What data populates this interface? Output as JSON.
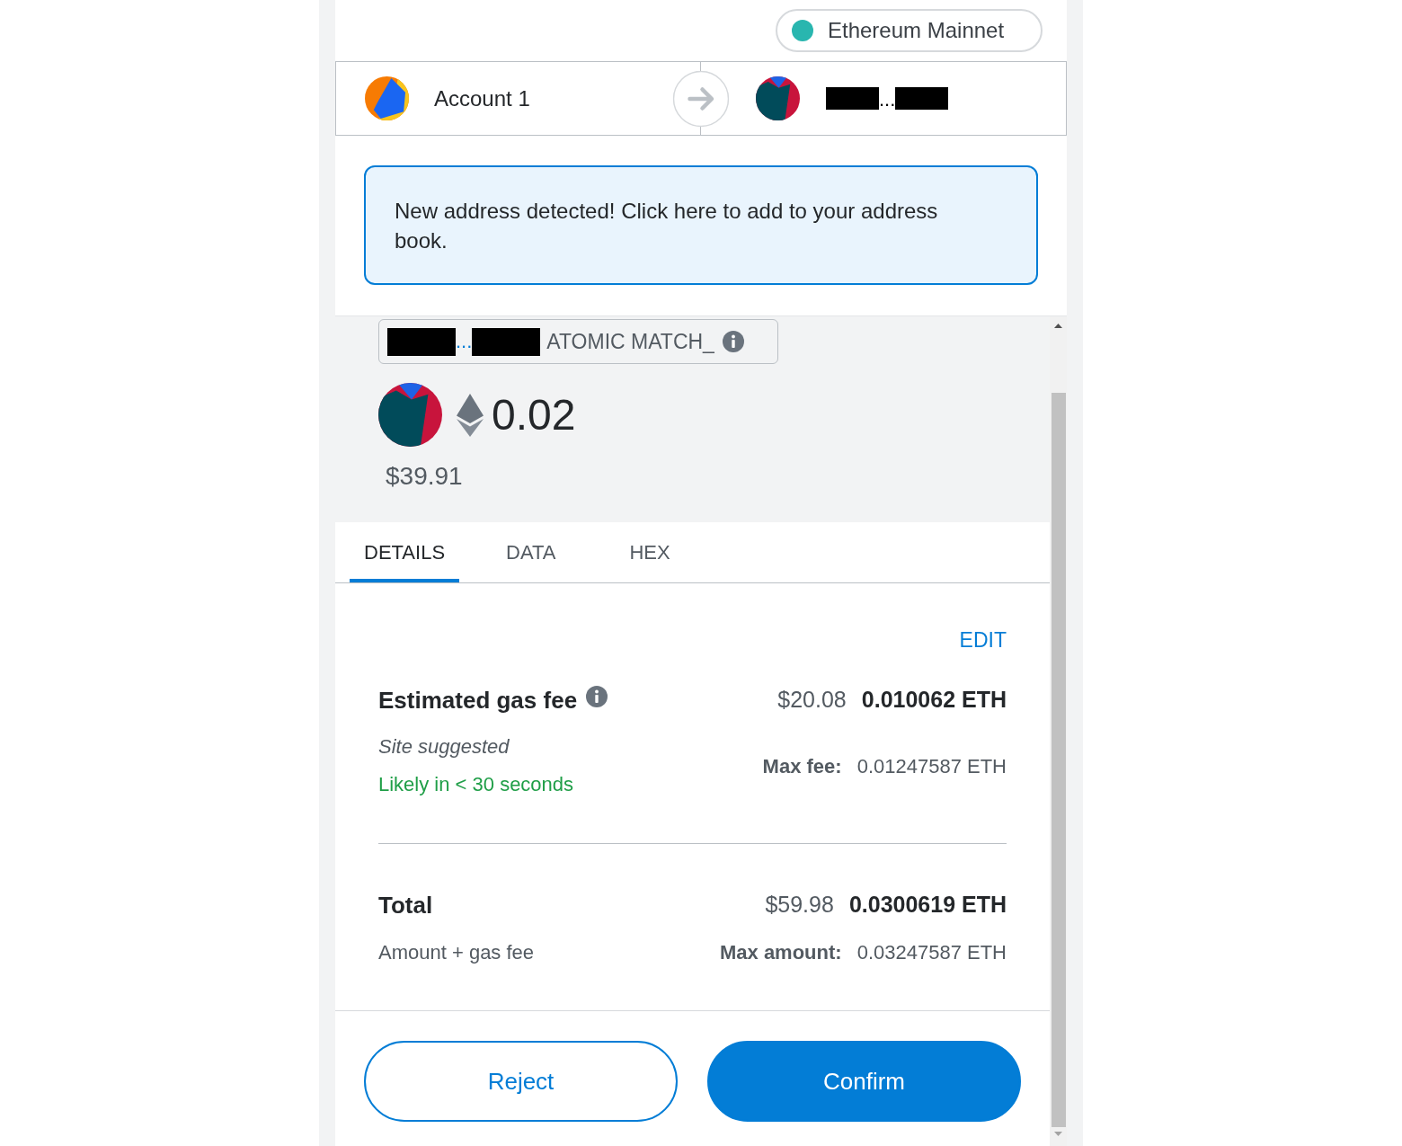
{
  "network": {
    "name": "Ethereum Mainnet"
  },
  "sender": {
    "name": "Account 1"
  },
  "recipient": {
    "address_ellipsis": "..."
  },
  "notice": {
    "text": "New address detected! Click here to add to your address book."
  },
  "transaction": {
    "address_ellipsis": "...",
    "method": "ATOMIC MATCH_",
    "amount": "0.02",
    "fiat": "$39.91"
  },
  "tabs": [
    {
      "label": "DETAILS",
      "selected": true
    },
    {
      "label": "DATA",
      "selected": false
    },
    {
      "label": "HEX",
      "selected": false
    }
  ],
  "details": {
    "edit": "EDIT",
    "gas_fee": {
      "label": "Estimated gas fee",
      "fiat": "$20.08",
      "eth": "0.010062 ETH",
      "source": "Site suggested",
      "timing": "Likely in < 30 seconds",
      "max_label": "Max fee:",
      "max_value": "0.01247587 ETH"
    },
    "total": {
      "label": "Total",
      "fiat": "$59.98",
      "eth": "0.0300619 ETH",
      "note": "Amount + gas fee",
      "max_label": "Max amount:",
      "max_value": "0.03247587 ETH"
    }
  },
  "buttons": [
    {
      "label": "Reject",
      "kind": "secondary"
    },
    {
      "label": "Confirm",
      "kind": "primary"
    }
  ]
}
